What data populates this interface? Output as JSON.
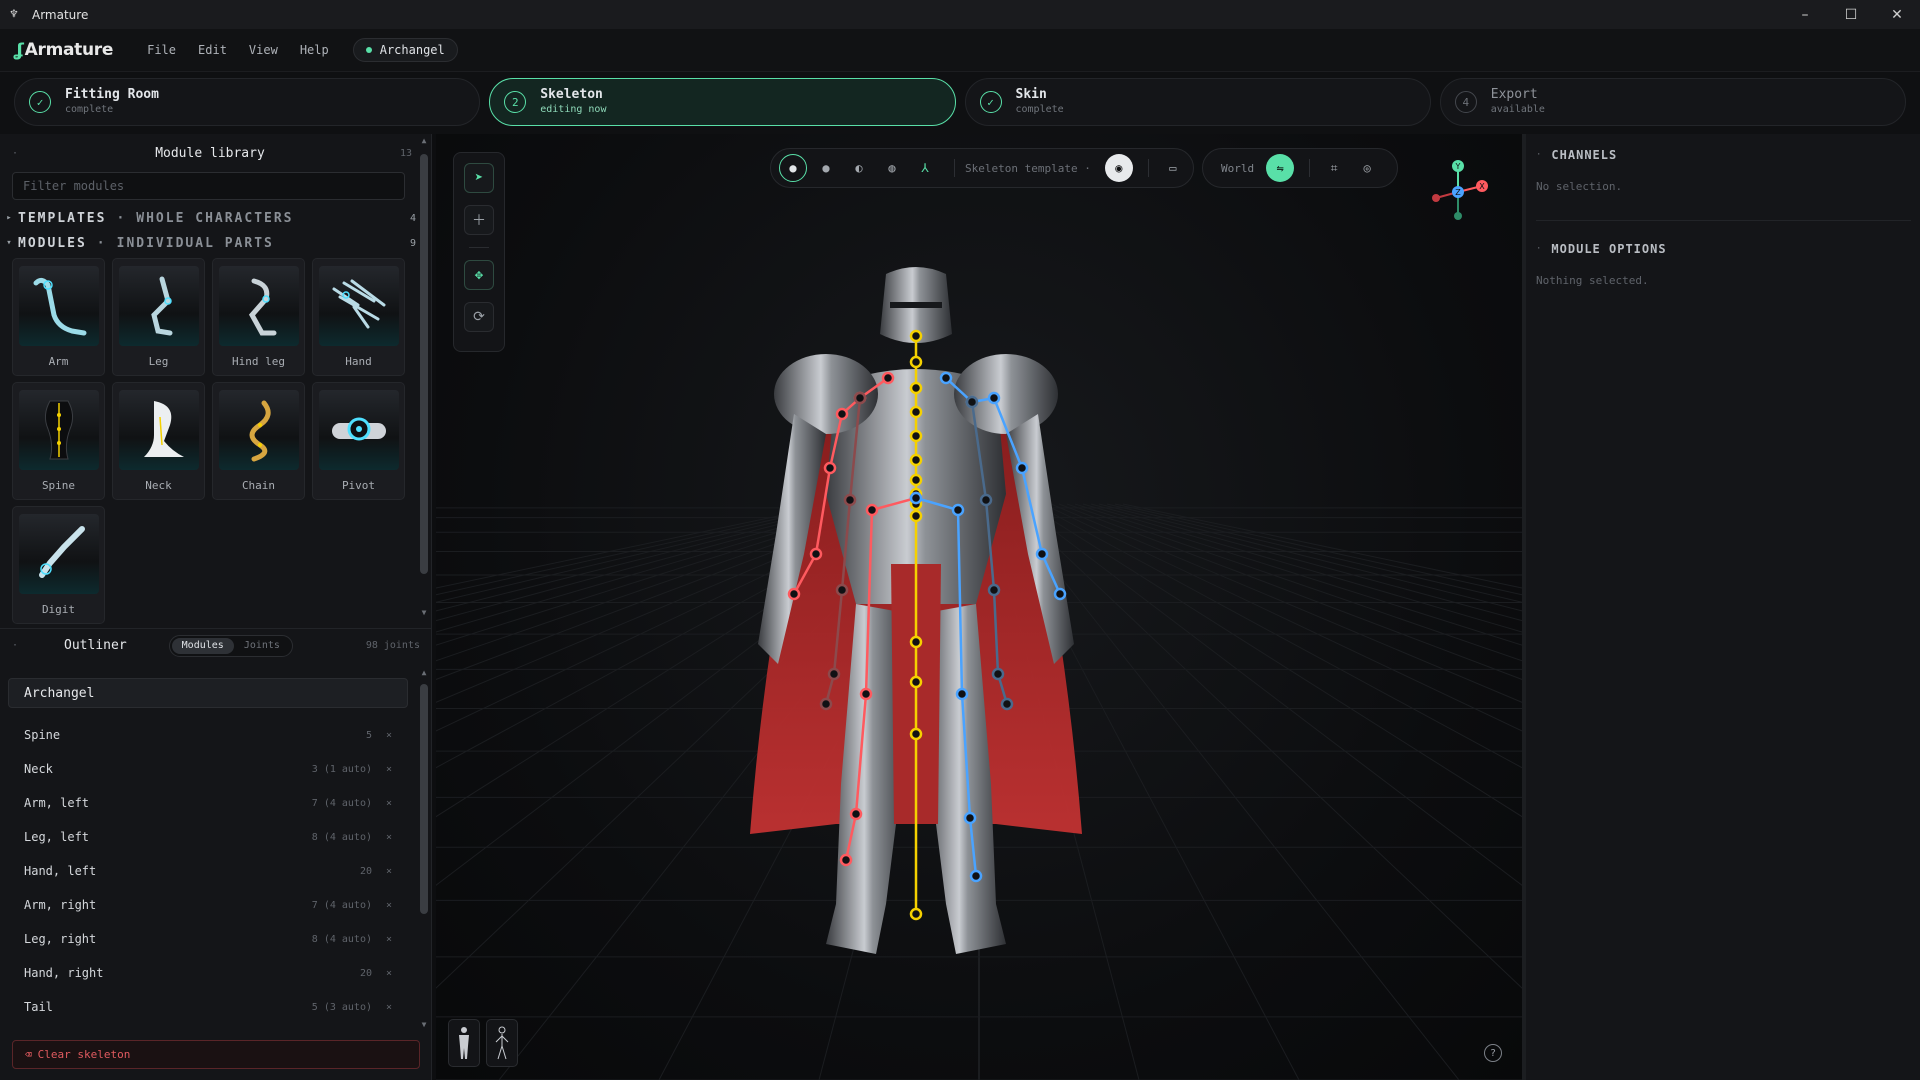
{
  "window": {
    "title": "Armature",
    "controls": [
      "–",
      "☐",
      "✕"
    ]
  },
  "app": {
    "logo_text": "Armature"
  },
  "menu": [
    "File",
    "Edit",
    "View",
    "Help"
  ],
  "project": {
    "name": "Archangel"
  },
  "steps": [
    {
      "index": "✓",
      "name": "Fitting Room",
      "status": "complete"
    },
    {
      "index": "2",
      "name": "Skeleton",
      "status": "editing now"
    },
    {
      "index": "✓",
      "name": "Skin",
      "status": "complete"
    },
    {
      "index": "4",
      "name": "Export",
      "status": "available"
    }
  ],
  "library": {
    "title": "Module library",
    "count": "13",
    "filter_placeholder": "Filter modules",
    "templates": {
      "key": "TEMPLATES",
      "value": "WHOLE CHARACTERS",
      "count": "4"
    },
    "modules": {
      "key": "MODULES",
      "value": "INDIVIDUAL PARTS",
      "count": "9"
    },
    "tiles": [
      "Arm",
      "Leg",
      "Hind leg",
      "Hand",
      "Spine",
      "Neck",
      "Chain",
      "Pivot",
      "Digit"
    ]
  },
  "outliner": {
    "title": "Outliner",
    "tabs": [
      "Modules",
      "Joints"
    ],
    "joint_count": "98 joints",
    "root": "Archangel",
    "rows": [
      {
        "name": "Spine",
        "count": "5"
      },
      {
        "name": "Neck",
        "count": "3 (1 auto)"
      },
      {
        "name": "Arm, left",
        "count": "7 (4 auto)"
      },
      {
        "name": "Leg, left",
        "count": "8 (4 auto)"
      },
      {
        "name": "Hand, left",
        "count": "20"
      },
      {
        "name": "Arm, right",
        "count": "7 (4 auto)"
      },
      {
        "name": "Leg, right",
        "count": "8 (4 auto)"
      },
      {
        "name": "Hand, right",
        "count": "20"
      },
      {
        "name": "Tail",
        "count": "5 (3 auto)"
      }
    ],
    "remove_glyph": "×",
    "clear_label": "Clear skeleton"
  },
  "viewport": {
    "template_label": "Skeleton template ·",
    "space_label": "World",
    "gizmo": {
      "y": "Y",
      "x": "X",
      "z": "Z"
    },
    "help": "?"
  },
  "right": {
    "channels": {
      "title": "CHANNELS",
      "body": "No selection."
    },
    "module_options": {
      "title": "MODULE OPTIONS",
      "body": "Nothing selected."
    }
  },
  "colors": {
    "accent": "#59e0a8",
    "left_side": "#ff5a5f",
    "right_side": "#4aa3ff",
    "center": "#f5d100",
    "danger": "#e05a5f"
  }
}
